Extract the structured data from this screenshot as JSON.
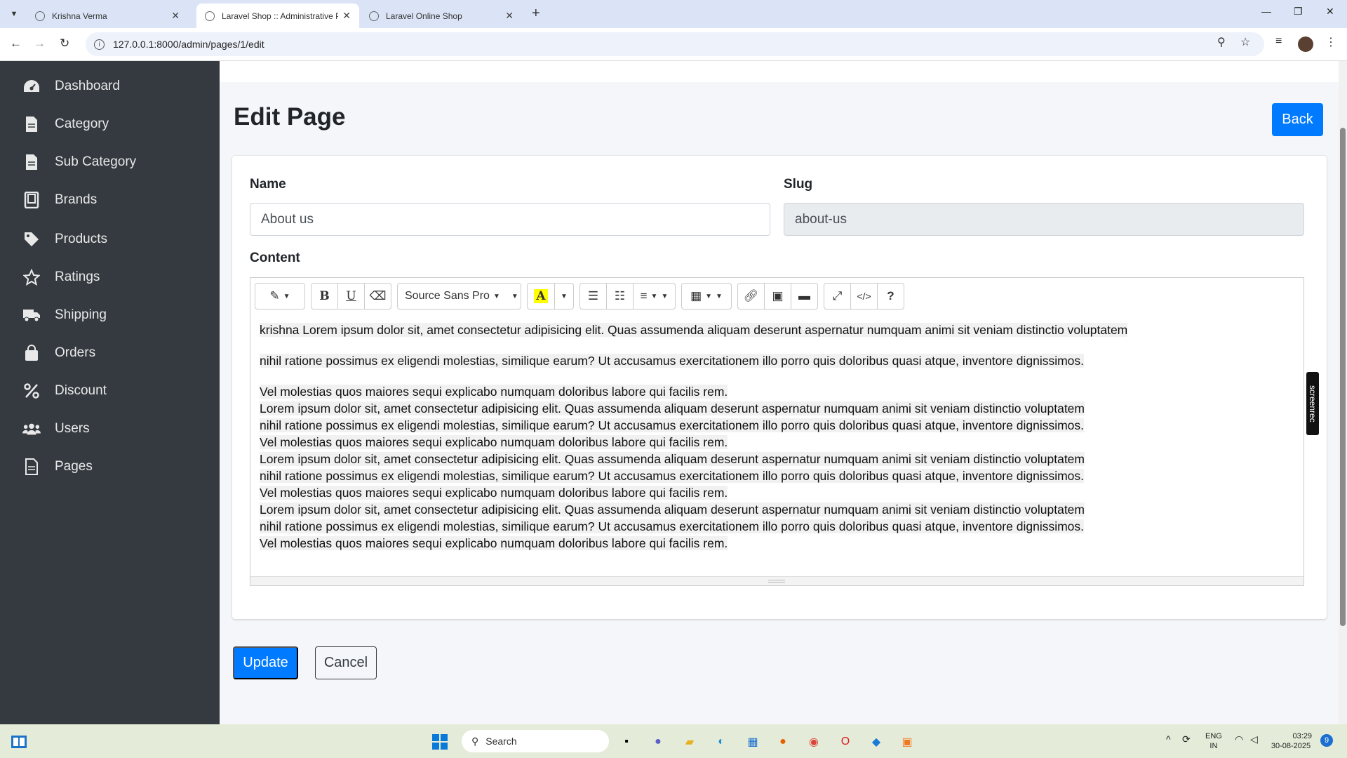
{
  "browser": {
    "tabs": [
      {
        "label": "Krishna Verma",
        "active": false
      },
      {
        "label": "Laravel Shop :: Administrative P",
        "active": true
      },
      {
        "label": "Laravel Online Shop",
        "active": false
      }
    ],
    "url": "127.0.0.1:8000/admin/pages/1/edit"
  },
  "sidebar": {
    "items": [
      {
        "label": "Dashboard",
        "icon": "dashboard-icon"
      },
      {
        "label": "Category",
        "icon": "file-icon"
      },
      {
        "label": "Sub Category",
        "icon": "file-icon"
      },
      {
        "label": "Brands",
        "icon": "book-icon"
      },
      {
        "label": "Products",
        "icon": "tag-icon"
      },
      {
        "label": "Ratings",
        "icon": "star-icon"
      },
      {
        "label": "Shipping",
        "icon": "truck-icon"
      },
      {
        "label": "Orders",
        "icon": "bag-icon"
      },
      {
        "label": "Discount",
        "icon": "percent-icon"
      },
      {
        "label": "Users",
        "icon": "users-icon"
      },
      {
        "label": "Pages",
        "icon": "file-icon"
      }
    ]
  },
  "page": {
    "title": "Edit Page",
    "back_label": "Back"
  },
  "form": {
    "name_label": "Name",
    "name_value": "About us",
    "slug_label": "Slug",
    "slug_value": "about-us",
    "content_label": "Content",
    "font_name": "Source Sans Pro",
    "content_lines": [
      "krishna Lorem ipsum dolor sit, amet consectetur adipisicing elit. Quas assumenda aliquam deserunt aspernatur numquam animi sit veniam distinctio voluptatem ",
      "nihil ratione possimus ex eligendi molestias, similique earum? Ut accusamus exercitationem illo porro quis doloribus quasi atque, inventore dignissimos.",
      " Vel molestias quos maiores sequi explicabo numquam doloribus labore qui facilis rem.",
      "Lorem ipsum dolor sit, amet consectetur adipisicing elit. Quas assumenda aliquam deserunt aspernatur numquam animi sit veniam distinctio voluptatem ",
      "nihil ratione possimus ex eligendi molestias, similique earum? Ut accusamus exercitationem illo porro quis doloribus quasi atque, inventore dignissimos.",
      " Vel molestias quos maiores sequi explicabo numquam doloribus labore qui facilis rem.",
      "Lorem ipsum dolor sit, amet consectetur adipisicing elit. Quas assumenda aliquam deserunt aspernatur numquam animi sit veniam distinctio voluptatem ",
      "nihil ratione possimus ex eligendi molestias, similique earum? Ut accusamus exercitationem illo porro quis doloribus quasi atque, inventore dignissimos.",
      " Vel molestias quos maiores sequi explicabo numquam doloribus labore qui facilis rem.",
      "Lorem ipsum dolor sit, amet consectetur adipisicing elit. Quas assumenda aliquam deserunt aspernatur numquam animi sit veniam distinctio voluptatem ",
      "nihil ratione possimus ex eligendi molestias, similique earum? Ut accusamus exercitationem illo porro quis doloribus quasi atque, inventore dignissimos.",
      " Vel molestias quos maiores sequi explicabo numquam doloribus labore qui facilis rem."
    ],
    "update_label": "Update",
    "cancel_label": "Cancel"
  },
  "overlay": {
    "screenrec_label": "screenrec"
  },
  "taskbar": {
    "search_placeholder": "Search",
    "lang": "ENG",
    "region": "IN",
    "time": "03:29",
    "date": "30-08-2025",
    "notification_count": "9"
  },
  "colors": {
    "primary": "#007bff",
    "sidebar_bg": "#343a40"
  }
}
